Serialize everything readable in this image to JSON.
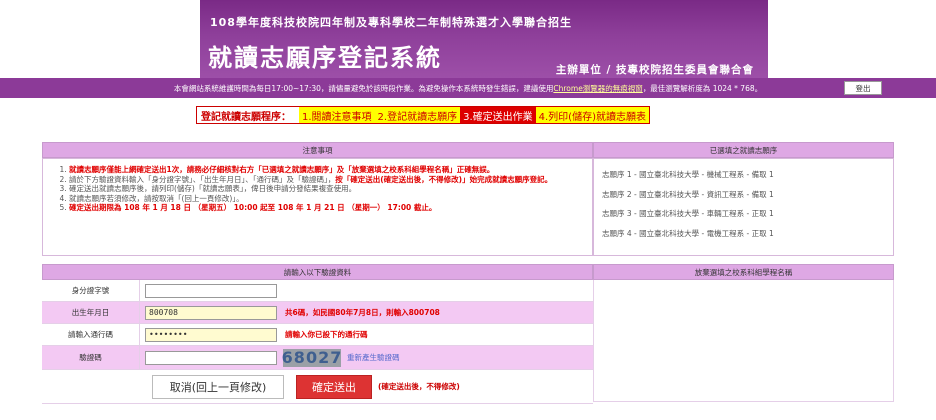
{
  "banner": {
    "subtitle": "108學年度科技校院四年制及專科學校二年制特殊選才入學聯合招生",
    "title": "就讀志願序登記系統",
    "organizer": "主辦單位 / 技專校院招生委員會聯合會"
  },
  "notice": {
    "text_before": "本會網站系統維護時間為每日17:00~17:30，請儘量避免於該時段作業。為避免操作本系統時發生錯誤，建議使用",
    "link": "Chrome瀏覽器的無痕視窗",
    "text_after": "，最佳瀏覽解析度為 1024 * 768。",
    "logout_label": "登出"
  },
  "steps": {
    "lead": "登記就讀志願程序：",
    "items": [
      {
        "label": "1.閱讀注意事項",
        "style": "yellow"
      },
      {
        "label": "2.登記就讀志願序",
        "style": "yellow"
      },
      {
        "label": "3.確定送出作業",
        "style": "red"
      },
      {
        "label": "4.列印(儲存)就讀志願表",
        "style": "yellow"
      }
    ]
  },
  "notes": {
    "header": "注意事項",
    "items": [
      {
        "red": "就讀志願序僅能上網確定送出1次，請務必仔細核對右方「已選填之就讀志願序」及「放棄選填之校系科組學程名稱」正確無誤。",
        "normal": ""
      },
      {
        "normal": "請於下方驗證資料輸入「身分證字號」、「出生年月日」、「通行碼」及「驗證碼」，",
        "red": "按「確定送出(確定送出後，不得修改)」始完成就讀志願序登記。"
      },
      {
        "normal": "確定送出就讀志願序後，請列印(儲存)「就讀志願表」，俾日後申請分發結果複查使用。",
        "red": ""
      },
      {
        "normal": "就讀志願序若須修改，請按取消「(回上一頁修改)」。",
        "red": ""
      },
      {
        "red": "確定送出期限為 108 年 1 月 18 日 （星期五） 10:00 起至 108 年 1 月 21 日 （星期一） 17:00 截止。",
        "normal": ""
      }
    ]
  },
  "choices": {
    "header": "已選填之就讀志願序",
    "items": [
      "志願序 1 - 國立臺北科技大學 - 機械工程系 - 備取 1",
      "志願序 2 - 國立臺北科技大學 - 資訊工程系 - 備取 1",
      "志願序 3 - 國立臺北科技大學 - 車輛工程系 - 正取 1",
      "志願序 4 - 國立臺北科技大學 - 電機工程系 - 正取 1"
    ]
  },
  "form": {
    "header": "請輸入以下驗證資料",
    "id_label": "身分證字號",
    "id_value": "",
    "birth_label": "出生年月日",
    "birth_value": "800708",
    "birth_hint": "共6碼，如民國80年7月8日，則輸入800708",
    "pass_label": "請輸入通行碼",
    "pass_value": "••••••••",
    "pass_hint": "請輸入你已設下的通行碼",
    "captcha_label": "驗證碼",
    "captcha_value": "",
    "captcha_code": "68027",
    "captcha_refresh": "重新產生驗證碼",
    "cancel_label": "取消(回上一頁修改)",
    "submit_label": "確定送出",
    "submit_warn": "(確定送出後，不得修改)"
  },
  "abandon": {
    "header": "放棄選填之校系科組學程名稱"
  }
}
